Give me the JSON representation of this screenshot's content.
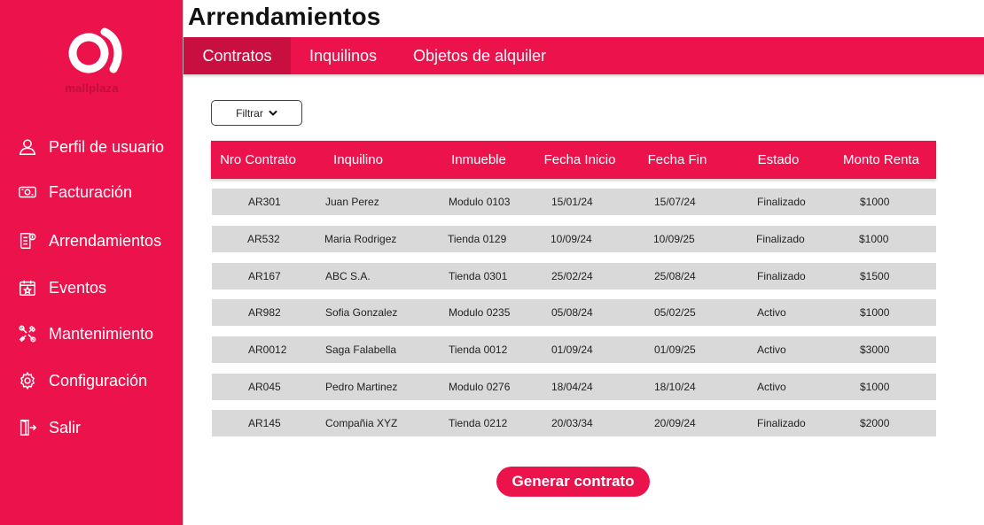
{
  "brand": {
    "logo_text": "mallplaza",
    "color": "#ec134d"
  },
  "sidebar": {
    "items": [
      {
        "label": "Perfil de usuario",
        "icon": "user-icon"
      },
      {
        "label": "Facturación",
        "icon": "money-icon"
      },
      {
        "label": "Arrendamientos",
        "icon": "document-dollar-icon"
      },
      {
        "label": "Eventos",
        "icon": "calendar-star-icon"
      },
      {
        "label": "Mantenimiento",
        "icon": "tools-icon"
      },
      {
        "label": "Configuración",
        "icon": "gear-icon"
      },
      {
        "label": "Salir",
        "icon": "exit-icon"
      }
    ]
  },
  "header": {
    "title": "Arrendamientos"
  },
  "tabs": [
    {
      "label": "Contratos",
      "active": true
    },
    {
      "label": "Inquilinos",
      "active": false
    },
    {
      "label": "Objetos de alquiler",
      "active": false
    }
  ],
  "filter": {
    "label": "Filtrar"
  },
  "table": {
    "columns": [
      "Nro Contrato",
      "Inquilino",
      "Inmueble",
      "Fecha Inicio",
      "Fecha Fin",
      "Estado",
      "Monto Renta"
    ],
    "rows": [
      [
        "AR301",
        "Juan Perez",
        "Modulo 0103",
        "15/01/24",
        "15/07/24",
        "Finalizado",
        "$1000"
      ],
      [
        "AR532",
        "Maria Rodrigez",
        "Tienda 0129",
        "10/09/24",
        "10/09/25",
        "Finalizado",
        "$1000"
      ],
      [
        "AR167",
        "ABC S.A.",
        "Tienda 0301",
        "25/02/24",
        "25/08/24",
        "Finalizado",
        "$1500"
      ],
      [
        "AR982",
        "Sofia Gonzalez",
        "Modulo 0235",
        "05/08/24",
        "05/02/25",
        "Activo",
        "$1000"
      ],
      [
        "AR0012",
        "Saga Falabella",
        "Tienda 0012",
        "01/09/24",
        "01/09/25",
        "Activo",
        "$3000"
      ],
      [
        "AR045",
        "Pedro Martinez",
        "Modulo 0276",
        "18/04/24",
        "18/10/24",
        "Activo",
        "$1000"
      ],
      [
        "AR145",
        "Compañia XYZ",
        "Tienda 0212",
        "20/03/34",
        "20/09/24",
        "Finalizado",
        "$2000"
      ]
    ]
  },
  "actions": {
    "generate_label": "Generar contrato"
  }
}
